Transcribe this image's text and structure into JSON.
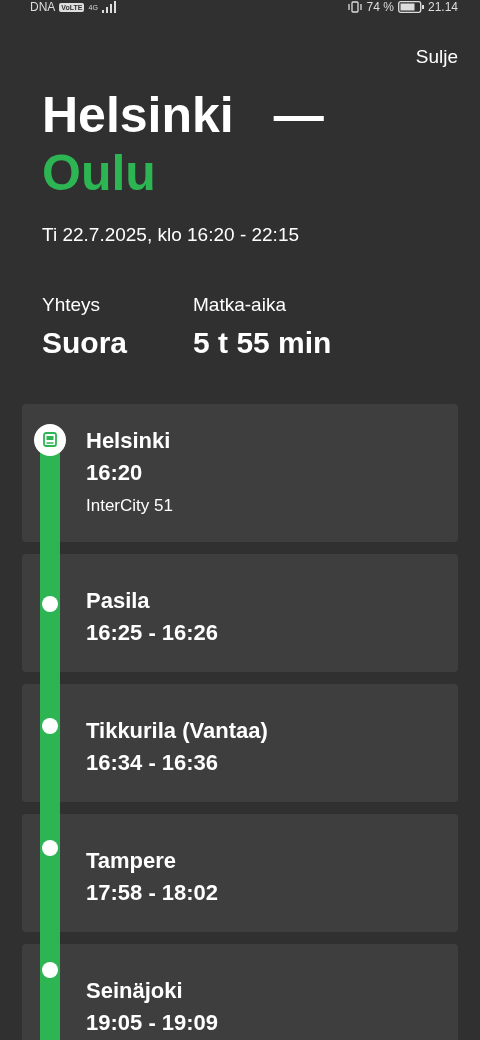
{
  "status_bar": {
    "carrier": "DNA",
    "volte": "VoLTE",
    "network": "4G",
    "battery": "74 %",
    "time": "21.14"
  },
  "close": "Sulje",
  "route": {
    "from": "Helsinki",
    "dash": "—",
    "to": "Oulu"
  },
  "date": "Ti 22.7.2025, klo 16:20 - 22:15",
  "summary": [
    {
      "label": "Yhteys",
      "value": "Suora"
    },
    {
      "label": "Matka-aika",
      "value": "5 t 55 min"
    }
  ],
  "stops": [
    {
      "kind": "origin",
      "name": "Helsinki",
      "time": "16:20",
      "train": "InterCity 51"
    },
    {
      "kind": "stop",
      "name": "Pasila",
      "time": "16:25 - 16:26"
    },
    {
      "kind": "stop",
      "name": "Tikkurila (Vantaa)",
      "time": "16:34 - 16:36"
    },
    {
      "kind": "stop",
      "name": "Tampere",
      "time": "17:58 - 18:02"
    },
    {
      "kind": "stop",
      "name": "Seinäjoki",
      "time": "19:05 - 19:09"
    }
  ]
}
